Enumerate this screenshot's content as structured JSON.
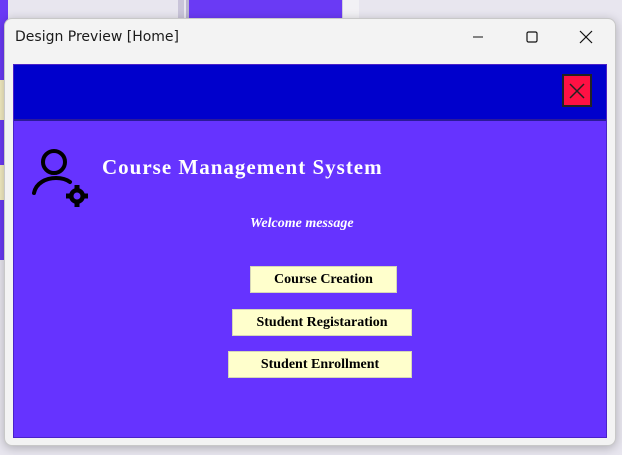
{
  "window": {
    "title": "Design Preview [Home]",
    "controls": [
      "minimize",
      "maximize",
      "close"
    ]
  },
  "app": {
    "title": "Course Management System",
    "welcome": "Welcome message",
    "header_color": "#0000cc",
    "background_color": "#6633ff",
    "close_button_color": "#ff1144",
    "icons": [
      "user-gear-icon",
      "close-icon"
    ],
    "buttons": {
      "course_creation": "Course Creation",
      "student_registration": "Student Registaration",
      "student_enrollment": "Student Enrollment"
    },
    "button_color": "#ffffcc"
  }
}
